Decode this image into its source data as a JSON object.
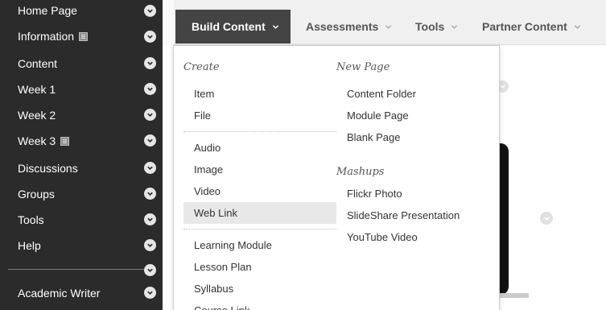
{
  "sidebar": {
    "items": [
      {
        "label": "Home Page",
        "doc_icon": false
      },
      {
        "label": "Information",
        "doc_icon": true
      },
      {
        "label": "Content",
        "doc_icon": false
      },
      {
        "label": "Week 1",
        "doc_icon": false
      },
      {
        "label": "Week 2",
        "doc_icon": false
      },
      {
        "label": "Week 3",
        "doc_icon": true
      },
      {
        "label": "Discussions",
        "doc_icon": false
      },
      {
        "label": "Groups",
        "doc_icon": false
      },
      {
        "label": "Tools",
        "doc_icon": false
      },
      {
        "label": "Help",
        "doc_icon": false
      },
      {
        "label": "Academic Writer",
        "doc_icon": false
      }
    ]
  },
  "tabs": {
    "build": "Build Content",
    "assessments": "Assessments",
    "tools": "Tools",
    "partner": "Partner Content"
  },
  "dropdown": {
    "create_heading": "Create",
    "new_page_heading": "New Page",
    "mashups_heading": "Mashups",
    "create_items": [
      "Item",
      "File",
      "Audio",
      "Image",
      "Video",
      "Web Link",
      "Learning Module",
      "Lesson Plan",
      "Syllabus",
      "Course Link"
    ],
    "new_page_items": [
      "Content Folder",
      "Module Page",
      "Blank Page"
    ],
    "mashup_items": [
      "Flickr Photo",
      "SlideShare Presentation",
      "YouTube Video"
    ],
    "highlighted": "Web Link"
  },
  "colors": {
    "sidebar_bg": "#2b2b2b",
    "active_tab_bg": "#444444",
    "menu_highlight": "#e8e8e8"
  }
}
